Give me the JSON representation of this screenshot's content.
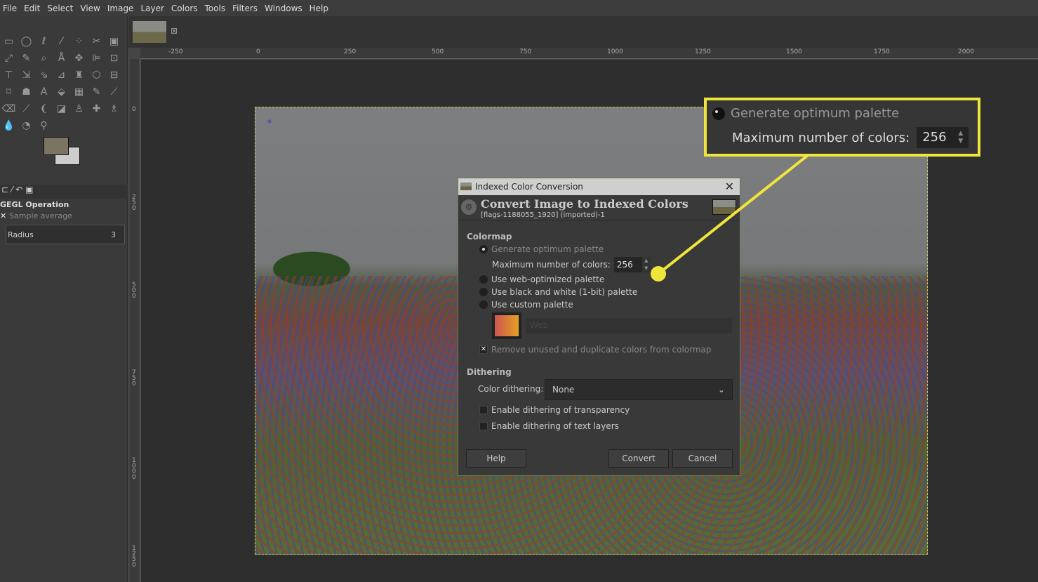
{
  "menu": [
    "File",
    "Edit",
    "Select",
    "View",
    "Image",
    "Layer",
    "Colors",
    "Tools",
    "Filters",
    "Windows",
    "Help"
  ],
  "toolbox": {
    "tools": [
      "▭",
      "◯",
      "ℓ",
      "⁄",
      "⁘",
      "✂",
      "▣",
      "⤢",
      "✎",
      "⌕",
      "Å",
      "✥",
      "⊫",
      "⊡",
      "⊤",
      "⇲",
      "⇘",
      "⊿",
      "♜",
      "⬡",
      "⊟",
      "⌑",
      "☗",
      "A",
      "⬙",
      "▦",
      "✎",
      "⟋",
      "⌫",
      "⟋",
      "❨",
      "◪",
      "♙",
      "✚",
      "♗",
      "💧",
      "◔",
      "⚲"
    ],
    "fg_color": "#7b7462",
    "bg_color": "#cccccc",
    "gegl_title": "GEGL Operation",
    "sample_label": "Sample average",
    "radius_label": "Radius",
    "radius_value": "3"
  },
  "rulers": {
    "h": [
      "-250",
      "0",
      "250",
      "500",
      "750",
      "1000",
      "1250",
      "1500",
      "1750",
      "2000"
    ],
    "v": [
      "0",
      "250",
      "500",
      "750",
      "1000",
      "1250"
    ]
  },
  "dialog": {
    "title": "Indexed Color Conversion",
    "heading": "Convert Image to Indexed Colors",
    "subtitle": "[flags-1188055_1920] (imported)-1",
    "colormap_label": "Colormap",
    "opt_optimum": "Generate optimum palette",
    "max_colors_label": "Maximum number of colors:",
    "max_colors": "256",
    "opt_web": "Use web-optimized palette",
    "opt_bw": "Use black and white (1-bit) palette",
    "opt_custom": "Use custom palette",
    "palette_name": "Web",
    "remove_unused": "Remove unused and duplicate colors from colormap",
    "dithering_label": "Dithering",
    "color_dithering_label": "Color dithering:",
    "color_dithering": "None",
    "dither_transparency": "Enable dithering of transparency",
    "dither_text": "Enable dithering of text layers",
    "help": "Help",
    "convert": "Convert",
    "cancel": "Cancel"
  },
  "callout": {
    "opt_optimum": "Generate optimum palette",
    "max_colors_label": "Maximum number of colors:",
    "max_colors": "256",
    "color": "#f0e53a"
  }
}
